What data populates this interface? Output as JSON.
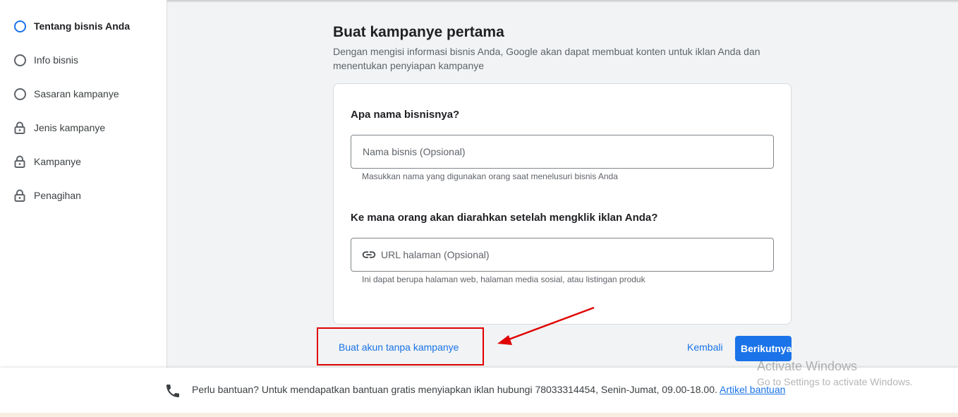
{
  "sidebar": {
    "steps": [
      {
        "label": "Tentang bisnis Anda",
        "icon": "circle-outline-icon",
        "state": "active"
      },
      {
        "label": "Info bisnis",
        "icon": "circle-outline-icon",
        "state": "pending"
      },
      {
        "label": "Sasaran kampanye",
        "icon": "circle-outline-icon",
        "state": "pending"
      },
      {
        "label": "Jenis kampanye",
        "icon": "lock-icon",
        "state": "locked"
      },
      {
        "label": "Kampanye",
        "icon": "lock-icon",
        "state": "locked"
      },
      {
        "label": "Penagihan",
        "icon": "lock-icon",
        "state": "locked"
      }
    ]
  },
  "main": {
    "title": "Buat kampanye pertama",
    "subtitle": "Dengan mengisi informasi bisnis Anda, Google akan dapat membuat konten untuk iklan Anda dan menentukan penyiapan kampanye",
    "business_name": {
      "question": "Apa nama bisnisnya?",
      "placeholder": "Nama bisnis (Opsional)",
      "value": "",
      "hint": "Masukkan nama yang digunakan orang saat menelusuri bisnis Anda"
    },
    "url": {
      "question": "Ke mana orang akan diarahkan setelah mengklik iklan Anda?",
      "placeholder": "URL halaman (Opsional)",
      "value": "",
      "icon": "link-icon",
      "hint": "Ini dapat berupa halaman web, halaman media sosial, atau listingan produk"
    }
  },
  "actions": {
    "skip_label": "Buat akun tanpa kampanye",
    "back_label": "Kembali",
    "next_label": "Berikutnya"
  },
  "footer": {
    "help_text": "Perlu bantuan? Untuk mendapatkan bantuan gratis menyiapkan iklan hubungi 78033314454, Senin-Jumat, 09.00-18.00.",
    "help_link": "Artikel bantuan"
  },
  "watermark": {
    "line1": "Activate Windows",
    "line2": "Go to Settings to activate Windows."
  },
  "colors": {
    "accent": "#1a73e8",
    "annotation": "#e00000"
  }
}
